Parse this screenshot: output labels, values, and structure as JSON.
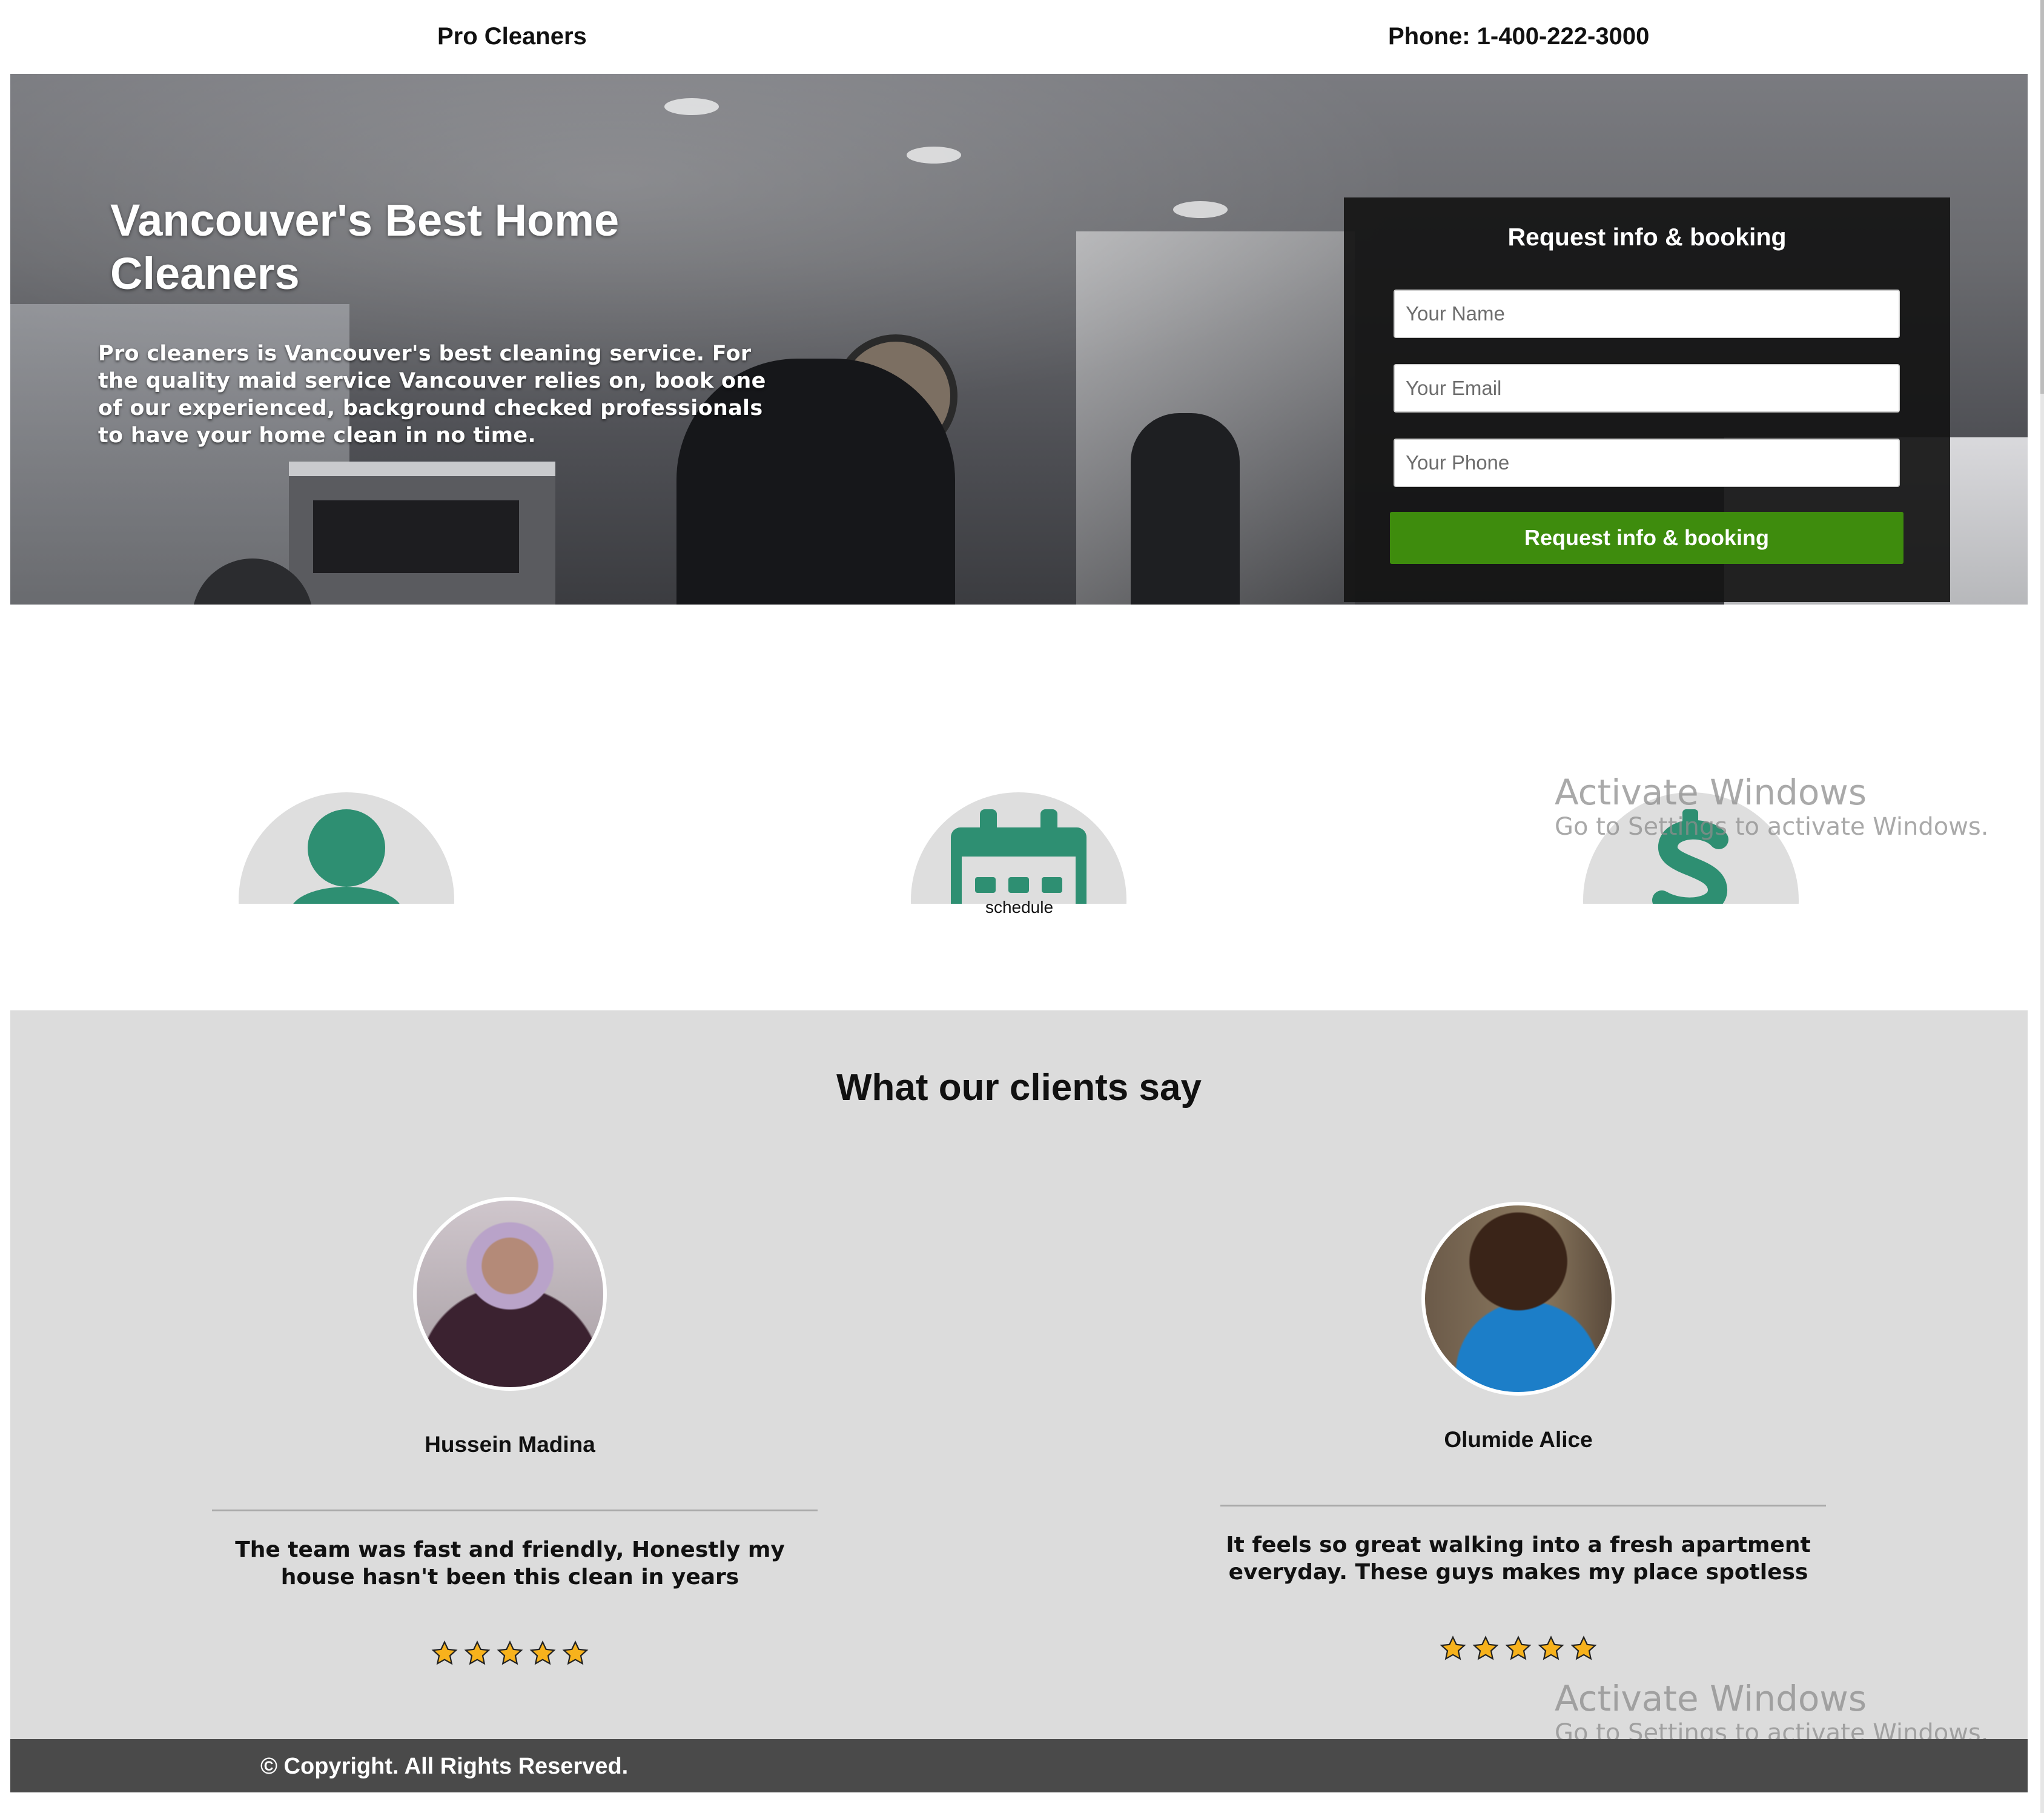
{
  "header": {
    "brand": "Pro Cleaners",
    "phone": "Phone: 1-400-222-3000"
  },
  "hero": {
    "title": "Vancouver's Best Home Cleaners",
    "description": "Pro cleaners is Vancouver's best cleaning service. For the quality maid service Vancouver relies on, book one of our experienced, background checked professionals to have your home clean in no time."
  },
  "form": {
    "title": "Request info & booking",
    "name_placeholder": "Your Name",
    "email_placeholder": "Your Email",
    "phone_placeholder": "Your Phone",
    "submit_label": "Request info & booking"
  },
  "features": [
    {
      "icon": "person-icon"
    },
    {
      "icon": "calendar-icon",
      "label": "schedule"
    },
    {
      "icon": "dollar-icon"
    }
  ],
  "watermark": {
    "title": "Activate Windows",
    "subtitle": "Go to Settings to activate Windows."
  },
  "testimonials": {
    "heading": "What our clients say",
    "items": [
      {
        "name": "Hussein Madina",
        "quote": "The team was fast and friendly, Honestly my house hasn't been this clean in years",
        "rating": 5
      },
      {
        "name": "Olumide Alice",
        "quote": "It feels so great walking into a fresh apartment everyday. These guys makes my place spotless",
        "rating": 5
      }
    ]
  },
  "footer": {
    "copyright": "© Copyright. All Rights Reserved."
  },
  "colors": {
    "accent_green": "#3e8c0d",
    "icon_teal": "#2e8f72",
    "testimonial_bg": "#dcdcdc",
    "footer_bg": "#4a4a4a"
  }
}
